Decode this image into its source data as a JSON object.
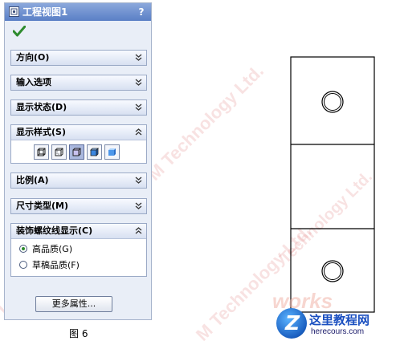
{
  "panel": {
    "title": "工程视图1",
    "help": "?",
    "groups": {
      "orientation": "方向(O)",
      "import_options": "输入选项",
      "display_state": "显示状态(D)",
      "display_style": "显示样式(S)",
      "scale": "比例(A)",
      "dimension_type": "尺寸类型(M)",
      "cosmetic_thread": "装饰螺纹线显示(C)"
    },
    "display_style_buttons": [
      "wireframe",
      "hidden-lines-visible",
      "hidden-lines-removed",
      "shaded-with-edges",
      "shaded"
    ],
    "display_style_selected": 2,
    "cosmetic_thread_options": {
      "high_quality": "高品质(G)",
      "draft_quality": "草稿品质(F)",
      "selected": "high_quality"
    },
    "more_properties": "更多属性..."
  },
  "caption": "图 6",
  "logo": {
    "name": "这里教程网",
    "domain": "herecours.com",
    "letter": "Z"
  },
  "colors": {
    "title_bar": "#5a7fc6",
    "panel_bg": "#e9eef7",
    "check_green": "#2e8b2e"
  }
}
